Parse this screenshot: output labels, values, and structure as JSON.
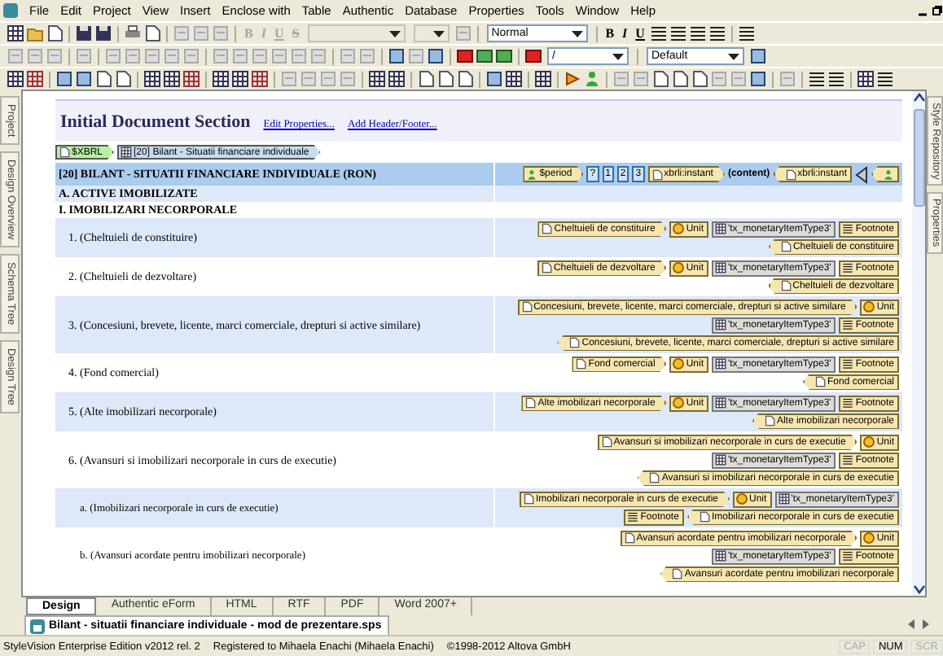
{
  "menu": [
    "File",
    "Edit",
    "Project",
    "View",
    "Insert",
    "Enclose with",
    "Table",
    "Authentic",
    "Database",
    "Properties",
    "Tools",
    "Window",
    "Help"
  ],
  "toolbar": {
    "format_left": [
      {
        "label": "B",
        "disabled": true
      },
      {
        "label": "I",
        "disabled": true
      },
      {
        "label": "U",
        "disabled": true
      },
      {
        "label": "S",
        "disabled": true
      }
    ],
    "style_combo": "Normal",
    "format_right": [
      {
        "label": "B",
        "disabled": false
      },
      {
        "label": "I",
        "disabled": false
      },
      {
        "label": "U",
        "disabled": false
      }
    ],
    "path_combo": "/",
    "default_combo": "Default"
  },
  "left_tabs": [
    "Project",
    "Design Overview",
    "Schema Tree",
    "Design Tree"
  ],
  "right_tabs": [
    "Style Repository",
    "Properties"
  ],
  "section": {
    "title": "Initial Document Section",
    "links": [
      "Edit Properties...",
      "Add Header/Footer..."
    ]
  },
  "breadcrumb": [
    {
      "kind": "xbrl",
      "text": "$XBRL"
    },
    {
      "kind": "table",
      "text": "[20] Bilant - Situatii financiare individuale"
    }
  ],
  "table": {
    "title": "[20] BILANT - SITUATII FINANCIARE INDIVIDUALE (RON)",
    "title_tags": [
      {
        "kind": "template",
        "text": "$period"
      },
      {
        "kind": "number",
        "text": "?"
      },
      {
        "kind": "number",
        "text": "1"
      },
      {
        "kind": "number",
        "text": "2"
      },
      {
        "kind": "number",
        "text": "3"
      },
      {
        "kind": "start",
        "text": "xbrli:instant"
      },
      {
        "kind": "content",
        "text": "(content)"
      },
      {
        "kind": "end",
        "text": "xbrli:instant"
      },
      {
        "kind": "close"
      },
      {
        "kind": "template_end"
      }
    ],
    "rows": [
      {
        "kind": "heading",
        "label": "A. ACTIVE IMOBILIZATE"
      },
      {
        "kind": "heading",
        "label": "I. IMOBILIZARI NECORPORALE"
      },
      {
        "kind": "item",
        "label": "1. (Cheltuieli de constituire)",
        "tag_lines": [
          [
            {
              "kind": "start",
              "text": "Cheltuieli de constituire"
            },
            {
              "kind": "unit",
              "text": "Unit"
            },
            {
              "kind": "type",
              "text": "'tx_monetaryItemType3'"
            },
            {
              "kind": "footnote",
              "text": "Footnote"
            }
          ],
          [
            {
              "kind": "end",
              "text": "Cheltuieli de constituire"
            }
          ]
        ]
      },
      {
        "kind": "item",
        "label": "2. (Cheltuieli de dezvoltare)",
        "tag_lines": [
          [
            {
              "kind": "start",
              "text": "Cheltuieli de dezvoltare"
            },
            {
              "kind": "unit",
              "text": "Unit"
            },
            {
              "kind": "type",
              "text": "'tx_monetaryItemType3'"
            },
            {
              "kind": "footnote",
              "text": "Footnote"
            }
          ],
          [
            {
              "kind": "end",
              "text": "Cheltuieli de dezvoltare"
            }
          ]
        ]
      },
      {
        "kind": "item",
        "label": "3. (Concesiuni, brevete, licente, marci comerciale, drepturi si active similare)",
        "tag_lines": [
          [
            {
              "kind": "start",
              "text": "Concesiuni, brevete, licente, marci comerciale, drepturi si active similare"
            },
            {
              "kind": "unit",
              "text": "Unit"
            }
          ],
          [
            {
              "kind": "type",
              "text": "'tx_monetaryItemType3'"
            },
            {
              "kind": "footnote",
              "text": "Footnote"
            }
          ],
          [
            {
              "kind": "end",
              "text": "Concesiuni, brevete, licente, marci comerciale, drepturi si active similare"
            }
          ]
        ]
      },
      {
        "kind": "item",
        "label": "4. (Fond comercial)",
        "tag_lines": [
          [
            {
              "kind": "start",
              "text": "Fond comercial"
            },
            {
              "kind": "unit",
              "text": "Unit"
            },
            {
              "kind": "type",
              "text": "'tx_monetaryItemType3'"
            },
            {
              "kind": "footnote",
              "text": "Footnote"
            }
          ],
          [
            {
              "kind": "end",
              "text": "Fond comercial"
            }
          ]
        ]
      },
      {
        "kind": "item",
        "label": "5. (Alte imobilizari necorporale)",
        "tag_lines": [
          [
            {
              "kind": "start",
              "text": "Alte imobilizari necorporale"
            },
            {
              "kind": "unit",
              "text": "Unit"
            },
            {
              "kind": "type",
              "text": "'tx_monetaryItemType3'"
            },
            {
              "kind": "footnote",
              "text": "Footnote"
            }
          ],
          [
            {
              "kind": "end",
              "text": "Alte imobilizari necorporale"
            }
          ]
        ]
      },
      {
        "kind": "item",
        "label": "6. (Avansuri si imobilizari necorporale in curs de executie)",
        "tag_lines": [
          [
            {
              "kind": "start",
              "text": "Avansuri si imobilizari necorporale in curs de executie"
            },
            {
              "kind": "unit",
              "text": "Unit"
            }
          ],
          [
            {
              "kind": "type",
              "text": "'tx_monetaryItemType3'"
            },
            {
              "kind": "footnote",
              "text": "Footnote"
            }
          ],
          [
            {
              "kind": "end",
              "text": "Avansuri si imobilizari necorporale in curs de executie"
            }
          ]
        ]
      },
      {
        "kind": "subitem",
        "label": "a. (Imobilizari necorporale in curs de executie)",
        "tag_lines": [
          [
            {
              "kind": "start",
              "text": "Imobilizari necorporale in curs de executie"
            },
            {
              "kind": "unit",
              "text": "Unit"
            },
            {
              "kind": "type",
              "text": "'tx_monetaryItemType3'"
            }
          ],
          [
            {
              "kind": "footnote",
              "text": "Footnote"
            },
            {
              "kind": "end",
              "text": "Imobilizari necorporale in curs de executie"
            }
          ]
        ]
      },
      {
        "kind": "subitem",
        "label": "b. (Avansuri acordate pentru imobilizari necorporale)",
        "tag_lines": [
          [
            {
              "kind": "start",
              "text": "Avansuri acordate pentru imobilizari necorporale"
            },
            {
              "kind": "unit",
              "text": "Unit"
            }
          ],
          [
            {
              "kind": "type",
              "text": "'tx_monetaryItemType3'"
            },
            {
              "kind": "footnote",
              "text": "Footnote"
            }
          ],
          [
            {
              "kind": "end",
              "text": "Avansuri acordate pentru imobilizari necorporale"
            }
          ]
        ]
      }
    ]
  },
  "view_tabs": [
    {
      "label": "Design",
      "selected": true
    },
    {
      "label": "Authentic eForm",
      "selected": false
    },
    {
      "label": "HTML",
      "selected": false
    },
    {
      "label": "RTF",
      "selected": false
    },
    {
      "label": "PDF",
      "selected": false
    },
    {
      "label": "Word 2007+",
      "selected": false
    }
  ],
  "document_tab": "Bilant - situatii financiare individuale - mod de prezentare.sps",
  "status_bar": {
    "texts": [
      "StyleVision Enterprise Edition v2012 rel. 2",
      "Registered to Mihaela Enachi (Mihaela Enachi)",
      "©1998-2012 Altova GmbH"
    ],
    "indicators": [
      {
        "label": "CAP",
        "on": false
      },
      {
        "label": "NUM",
        "on": true
      },
      {
        "label": "SCR",
        "on": false
      }
    ]
  }
}
